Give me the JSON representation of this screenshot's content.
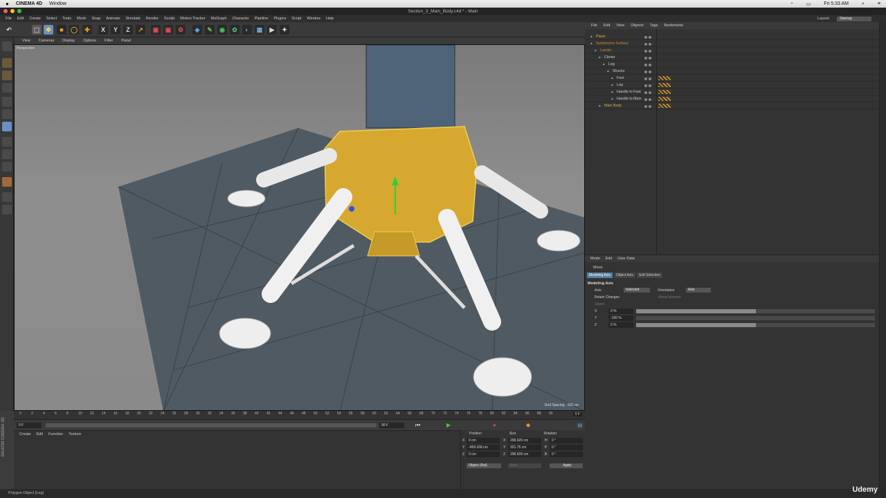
{
  "mac": {
    "apple": "",
    "app": "CINEMA 4D",
    "menu": "Window",
    "clock": "Fri 5:33 AM"
  },
  "window_title": "Section_3_Main_Body.c4d * - Main",
  "menubar": [
    "File",
    "Edit",
    "Create",
    "Select",
    "Tools",
    "Mesh",
    "Snap",
    "Animate",
    "Simulate",
    "Render",
    "Sculpt",
    "Motion Tracker",
    "MoGraph",
    "Character",
    "Pipeline",
    "Plugins",
    "Script",
    "Window",
    "Help"
  ],
  "layout": {
    "label": "Layout:",
    "value": "Startup"
  },
  "viewport": {
    "menu": [
      "View",
      "Cameras",
      "Display",
      "Options",
      "Filter",
      "Panel"
    ],
    "label": "Perspective",
    "grid_spacing": "Grid Spacing : 100 cm"
  },
  "timeline": {
    "ticks": [
      "0",
      "2",
      "4",
      "6",
      "8",
      "10",
      "12",
      "14",
      "16",
      "18",
      "20",
      "22",
      "24",
      "26",
      "28",
      "30",
      "32",
      "34",
      "36",
      "38",
      "40",
      "42",
      "44",
      "46",
      "48",
      "50",
      "52",
      "54",
      "56",
      "58",
      "60",
      "62",
      "64",
      "66",
      "68",
      "70",
      "72",
      "74",
      "76",
      "78",
      "80",
      "82",
      "84",
      "86",
      "88",
      "90"
    ],
    "current": "0 F",
    "start": "0 F",
    "end": "90 F",
    "end2": "90 F"
  },
  "manager": {
    "menu": [
      "Create",
      "Edit",
      "Function",
      "Texture"
    ]
  },
  "coords": {
    "headers": [
      "Position",
      "Size",
      "Rotation"
    ],
    "rows": [
      {
        "axis": "X",
        "pos": "0 cm",
        "sa": "X",
        "size": "298.929 cm",
        "ra": "H",
        "rot": "0 °"
      },
      {
        "axis": "Y",
        "pos": "-459.168 cm",
        "sa": "Y",
        "size": "321.75 cm",
        "ra": "P",
        "rot": "0 °"
      },
      {
        "axis": "Z",
        "pos": "0 cm",
        "sa": "Z",
        "size": "298.929 cm",
        "ra": "B",
        "rot": "0 °"
      }
    ],
    "mode": "Object (Rel)",
    "size_mode": "Size",
    "apply": "Apply"
  },
  "status": "Polygon Object [Leg]",
  "maxon": "MAXON CINEMA 4D",
  "objects": {
    "menu": [
      "File",
      "Edit",
      "View",
      "Objects",
      "Tags",
      "Bookmarks"
    ],
    "items": [
      {
        "name": "Plane",
        "indent": 0,
        "color": "#e0b040",
        "tag": false
      },
      {
        "name": "Subdivision Surface",
        "indent": 0,
        "color": "#d08a2a",
        "tag": false
      },
      {
        "name": "Lander",
        "indent": 1,
        "color": "#d08a2a",
        "tag": false
      },
      {
        "name": "Cloner",
        "indent": 2,
        "color": "#cfcfcf",
        "tag": false
      },
      {
        "name": "Leg",
        "indent": 3,
        "color": "#cfcfcf",
        "tag": false
      },
      {
        "name": "Shocks",
        "indent": 4,
        "color": "#cfcfcf",
        "tag": false
      },
      {
        "name": "Feet",
        "indent": 5,
        "color": "#cfcfcf",
        "tag": true
      },
      {
        "name": "Leg",
        "indent": 5,
        "color": "#cfcfcf",
        "tag": true
      },
      {
        "name": "Handle to Feet",
        "indent": 5,
        "color": "#cfcfcf",
        "tag": true
      },
      {
        "name": "Handle to Main",
        "indent": 5,
        "color": "#cfcfcf",
        "tag": true
      },
      {
        "name": "Main Body",
        "indent": 2,
        "color": "#e0b040",
        "tag": true
      }
    ]
  },
  "attributes": {
    "menu": [
      "Mode",
      "Edit",
      "User Data"
    ],
    "tool": "Move",
    "tabs": [
      "Modeling Axis",
      "Object Axis",
      "Soft Selection"
    ],
    "section": "Modeling Axis",
    "axis_label": "Axis",
    "axis_value": "Selected",
    "orientation_label": "Orientation",
    "orientation_value": "Axis",
    "retain": "Retain Changes",
    "along_normals": "Along Normals",
    "object": "Object",
    "sliders": [
      {
        "axis": "X",
        "value": "0 %",
        "fill": 0.5
      },
      {
        "axis": "Y",
        "value": "-100 %",
        "fill": 0
      },
      {
        "axis": "Z",
        "value": "0 %",
        "fill": 0.5
      }
    ]
  },
  "udemy": "Udemy"
}
